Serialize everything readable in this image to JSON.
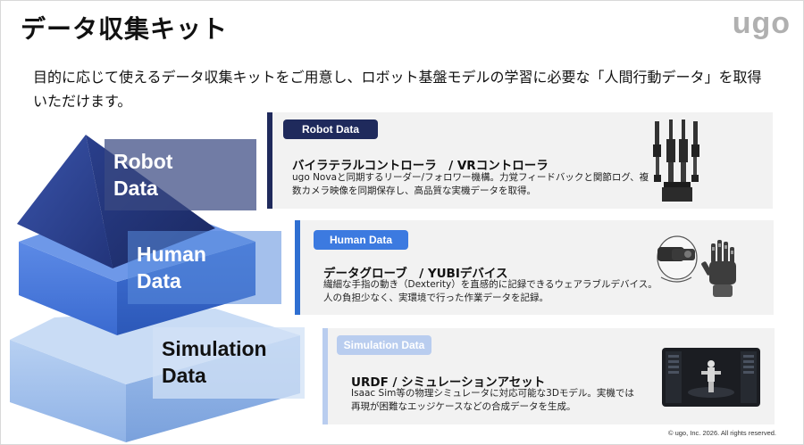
{
  "header": {
    "title": "データ収集キット",
    "logo": "ugo"
  },
  "intro": "目的に応じて使えるデータ収集キットをご用意し、ロボット基盤モデルの学習に必要な「人間行動データ」を取得いただけます。",
  "tiers": {
    "robot": {
      "label_line1": "Robot",
      "label_line2": "Data",
      "badge": "Robot Data",
      "heading": "バイラテラルコントローラ　/ VRコントローラ",
      "desc_line1": "ugo Novaと同期するリーダー/フォロワー機構。力覚フィードバックと関節ログ、複",
      "desc_line2": "数カメラ映像を同期保存し、高品質な実機データを取得。",
      "picture": "bilateral-controller-arms"
    },
    "human": {
      "label_line1": "Human",
      "label_line2": "Data",
      "badge": "Human Data",
      "heading": "データグローブ　/ YUBIデバイス",
      "desc_line1": "繊細な手指の動き（Dexterity）を直感的に記録できるウェアラブルデバイス。",
      "desc_line2": "人の負担少なく、実環境で行った作業データを記録。",
      "picture": "vr-headset-and-data-glove"
    },
    "simulation": {
      "label_line1": "Simulation",
      "label_line2": "Data",
      "badge": "Simulation Data",
      "heading": "URDF / シミュレーションアセット",
      "desc_line1": "Isaac Sim等の物理シミュレータに対応可能な3Dモデル。実機では",
      "desc_line2": "再現が困難なエッジケースなどの合成データを生成。",
      "picture": "simulation-screen"
    }
  },
  "footer": "© ugo, Inc. 2026. All rights reserved.",
  "colors": {
    "robot_accent": "#1f2a5c",
    "human_accent": "#3c7ae0",
    "sim_accent": "#b9cdef",
    "pyramid_top": "#2f4596",
    "pyramid_mid": "#4f7fe0",
    "pyramid_bottom": "#a9c6ef"
  }
}
